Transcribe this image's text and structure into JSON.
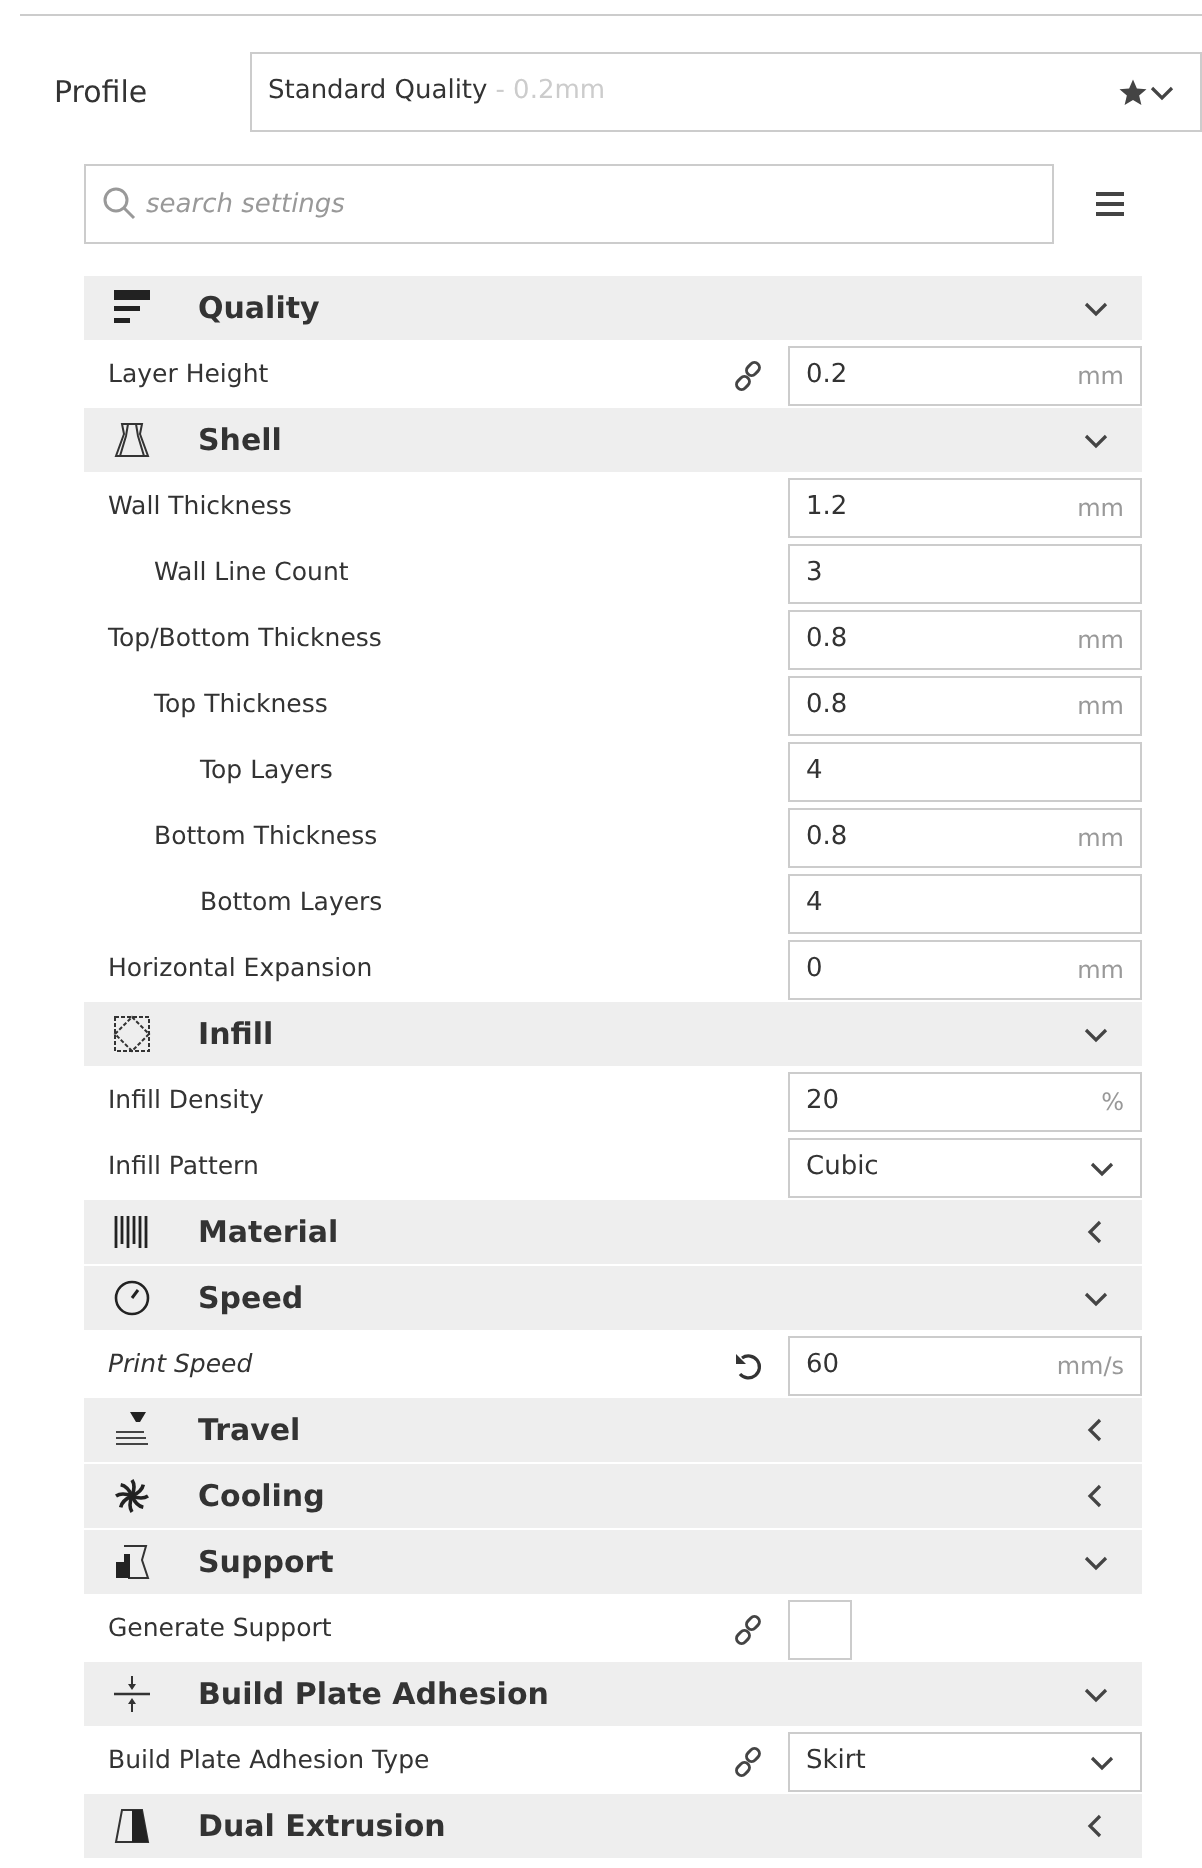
{
  "profile": {
    "label": "Profile",
    "name": "Standard Quality",
    "detail": "- 0.2mm"
  },
  "search": {
    "placeholder": "search settings"
  },
  "sections": [
    {
      "kind": "quality",
      "title": "Quality",
      "expanded": true,
      "settings": [
        {
          "kind": "number",
          "label": "Layer Height",
          "linked": true,
          "modified": false,
          "value": "0.2",
          "unit": "mm"
        }
      ]
    },
    {
      "kind": "shell",
      "title": "Shell",
      "expanded": true,
      "settings": [
        {
          "kind": "number",
          "label": "Wall Thickness",
          "linked": false,
          "modified": false,
          "value": "1.2",
          "unit": "mm",
          "children": [
            {
              "kind": "number",
              "label": "Wall Line Count",
              "linked": false,
              "modified": false,
              "value": "3"
            }
          ]
        },
        {
          "kind": "number",
          "label": "Top/Bottom Thickness",
          "linked": false,
          "modified": false,
          "value": "0.8",
          "unit": "mm",
          "children": [
            {
              "kind": "number",
              "label": "Top Thickness",
              "linked": false,
              "modified": false,
              "value": "0.8",
              "unit": "mm",
              "children": [
                {
                  "kind": "number",
                  "label": "Top Layers",
                  "linked": false,
                  "modified": false,
                  "value": "4"
                }
              ]
            },
            {
              "kind": "number",
              "label": "Bottom Thickness",
              "linked": false,
              "modified": false,
              "value": "0.8",
              "unit": "mm",
              "children": [
                {
                  "kind": "number",
                  "label": "Bottom Layers",
                  "linked": false,
                  "modified": false,
                  "value": "4"
                }
              ]
            }
          ]
        },
        {
          "kind": "number",
          "label": "Horizontal Expansion",
          "linked": false,
          "modified": false,
          "value": "0",
          "unit": "mm"
        }
      ]
    },
    {
      "kind": "infill",
      "title": "Infill",
      "expanded": true,
      "settings": [
        {
          "kind": "number",
          "label": "Infill Density",
          "linked": false,
          "modified": false,
          "value": "20",
          "unit": "%"
        },
        {
          "kind": "select",
          "label": "Infill Pattern",
          "linked": false,
          "modified": false,
          "value": "Cubic"
        }
      ]
    },
    {
      "kind": "material",
      "title": "Material",
      "expanded": false
    },
    {
      "kind": "speed",
      "title": "Speed",
      "expanded": true,
      "settings": [
        {
          "kind": "number",
          "label": "Print Speed",
          "linked": false,
          "modified": true,
          "value": "60",
          "unit": "mm/s"
        }
      ]
    },
    {
      "kind": "travel",
      "title": "Travel",
      "expanded": false
    },
    {
      "kind": "cooling",
      "title": "Cooling",
      "expanded": false
    },
    {
      "kind": "support",
      "title": "Support",
      "expanded": true,
      "settings": [
        {
          "kind": "checkbox",
          "label": "Generate Support",
          "linked": true,
          "modified": false,
          "checked": false
        }
      ]
    },
    {
      "kind": "adhesion",
      "title": "Build Plate Adhesion",
      "expanded": true,
      "settings": [
        {
          "kind": "select",
          "label": "Build Plate Adhesion Type",
          "linked": true,
          "modified": false,
          "value": "Skirt"
        }
      ]
    },
    {
      "kind": "dual",
      "title": "Dual Extrusion",
      "expanded": false
    }
  ]
}
